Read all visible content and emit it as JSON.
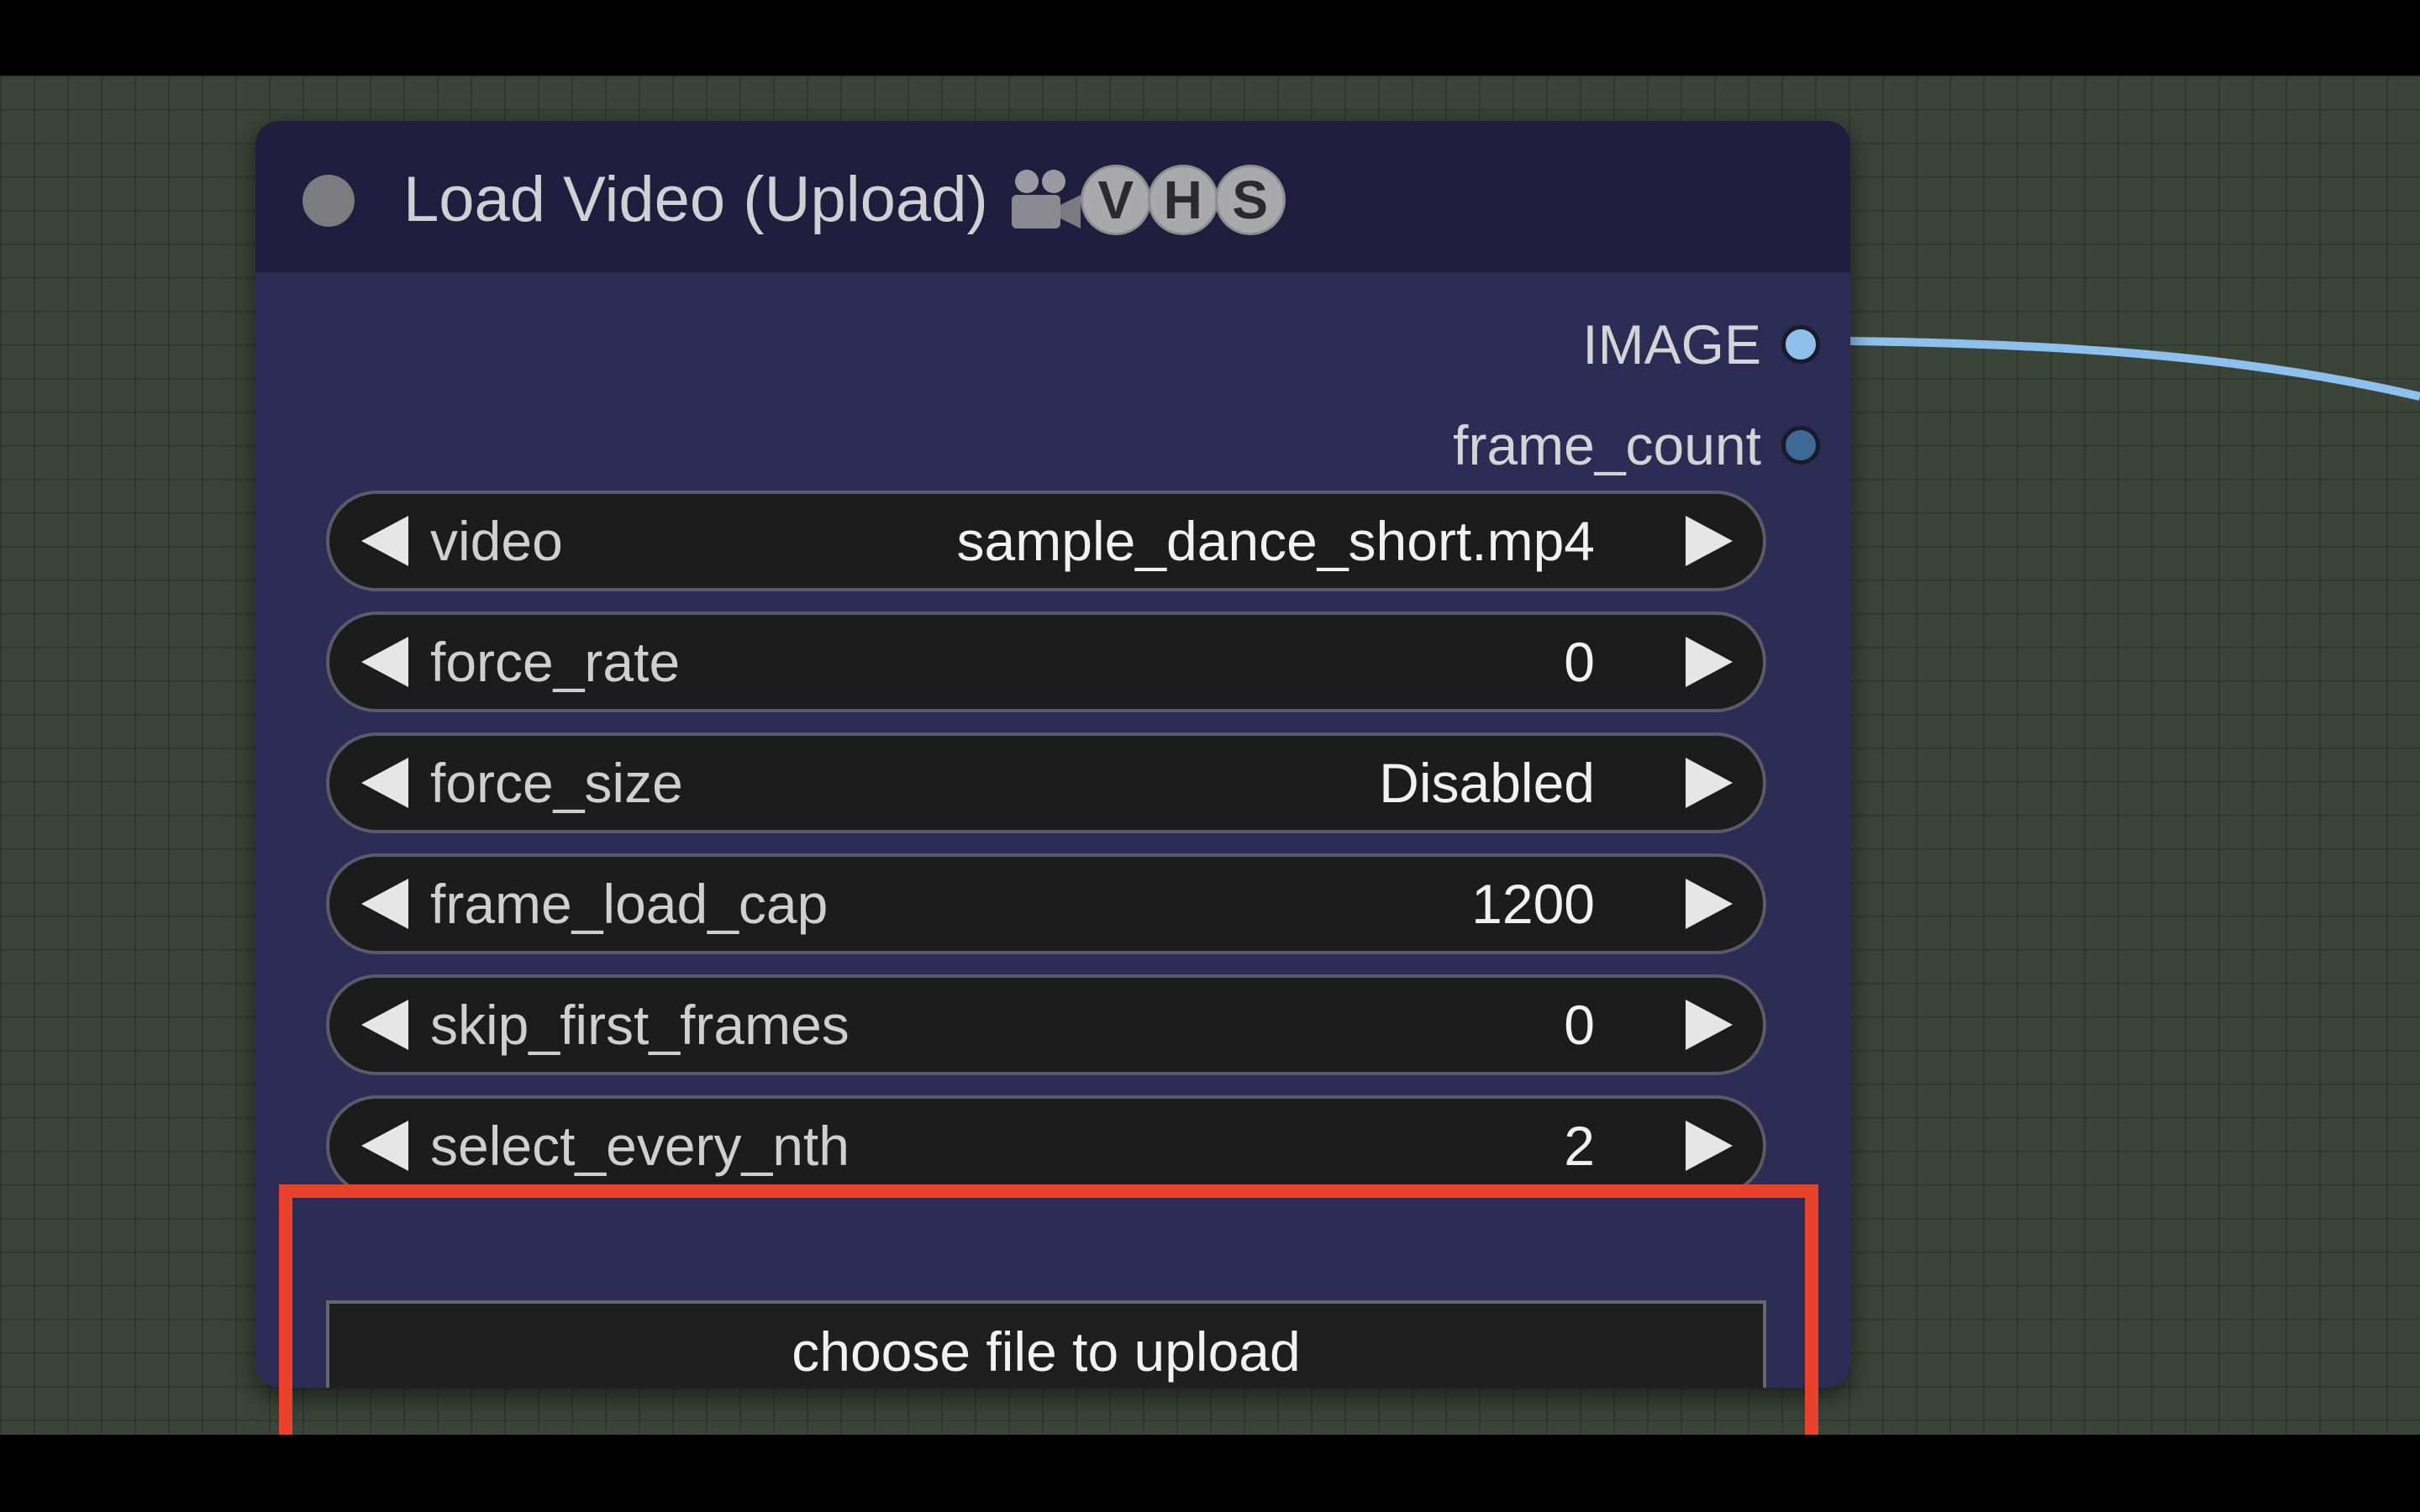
{
  "node": {
    "title": "Load Video (Upload)",
    "title_icon": "movie-camera-icon",
    "badges": [
      "V",
      "H",
      "S"
    ],
    "outputs": [
      {
        "label": "IMAGE",
        "slot_color": "#8ec0ee"
      },
      {
        "label": "frame_count",
        "slot_color": "#3d6a96"
      }
    ],
    "widgets": [
      {
        "name": "video",
        "value": "sample_dance_short.mp4"
      },
      {
        "name": "force_rate",
        "value": "0"
      },
      {
        "name": "force_size",
        "value": "Disabled"
      },
      {
        "name": "frame_load_cap",
        "value": "1200"
      },
      {
        "name": "skip_first_frames",
        "value": "0"
      },
      {
        "name": "select_every_nth",
        "value": "2"
      }
    ],
    "upload_button_label": "choose file to upload"
  },
  "colors": {
    "canvas": "#3a4439",
    "node_body": "#2d2c55",
    "node_header": "#1f1e3f",
    "link_wire": "#8ec0ee",
    "highlight": "#e8412c"
  }
}
